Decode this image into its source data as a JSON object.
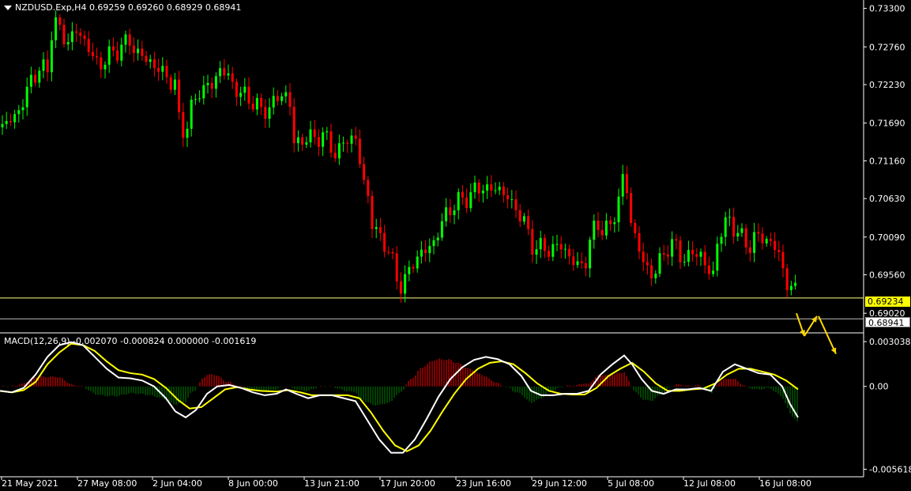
{
  "header": {
    "symbol_line": "NZDUSD.Exp,H4  0.69259 0.69260 0.68929 0.68941"
  },
  "macd_header": {
    "label": "MACD(12,26,9) -0.002070 -0.000824 0.000000 -0.001619"
  },
  "price_tags": {
    "horizontal_line": "0.69234",
    "current": "0.68941"
  },
  "colors": {
    "background": "#000000",
    "bull": "#00ff00",
    "bear": "#ff0000",
    "grid_line": "#ffffff",
    "level_line": "#ffff80",
    "signal": "#ffff00",
    "macd_main": "#ffffff",
    "hist_pos": "#ff0000",
    "hist_neg": "#008000",
    "arrow": "#ffd700"
  },
  "chart_data": [
    {
      "type": "candlestick",
      "title": "NZDUSD.Exp,H4",
      "y_ticks": [
        "0.73300",
        "0.72760",
        "0.72230",
        "0.71690",
        "0.71160",
        "0.70630",
        "0.70090",
        "0.69560",
        "0.69020"
      ],
      "ylim": [
        0.688,
        0.7334
      ],
      "x_ticks": [
        "21 May 2021",
        "27 May 08:00",
        "2 Jun 04:00",
        "8 Jun 00:00",
        "13 Jun 21:00",
        "17 Jun 20:00",
        "23 Jun 16:00",
        "29 Jun 12:00",
        "5 Jul 08:00",
        "12 Jul 08:00",
        "16 Jul 08:00"
      ],
      "horizontal_level": 0.69234,
      "last_price": 0.68941,
      "close_path": [
        [
          0,
          0.7163
        ],
        [
          10,
          0.717
        ],
        [
          20,
          0.718
        ],
        [
          30,
          0.72
        ],
        [
          40,
          0.7232
        ],
        [
          50,
          0.7245
        ],
        [
          60,
          0.7242
        ],
        [
          67,
          0.7315
        ],
        [
          73,
          0.7305
        ],
        [
          80,
          0.729
        ],
        [
          88,
          0.7283
        ],
        [
          95,
          0.73
        ],
        [
          102,
          0.7292
        ],
        [
          110,
          0.728
        ],
        [
          118,
          0.726
        ],
        [
          125,
          0.7248
        ],
        [
          135,
          0.7262
        ],
        [
          145,
          0.7268
        ],
        [
          155,
          0.7278
        ],
        [
          165,
          0.7285
        ],
        [
          172,
          0.7268
        ],
        [
          180,
          0.7262
        ],
        [
          190,
          0.7256
        ],
        [
          198,
          0.7245
        ],
        [
          208,
          0.724
        ],
        [
          215,
          0.7228
        ],
        [
          222,
          0.7222
        ],
        [
          228,
          0.716
        ],
        [
          236,
          0.7162
        ],
        [
          244,
          0.7195
        ],
        [
          252,
          0.7215
        ],
        [
          260,
          0.7218
        ],
        [
          268,
          0.7222
        ],
        [
          278,
          0.7245
        ],
        [
          288,
          0.7236
        ],
        [
          296,
          0.722
        ],
        [
          305,
          0.721
        ],
        [
          313,
          0.7205
        ],
        [
          322,
          0.7198
        ],
        [
          330,
          0.7185
        ],
        [
          340,
          0.719
        ],
        [
          350,
          0.7202
        ],
        [
          358,
          0.7212
        ],
        [
          366,
          0.7205
        ],
        [
          372,
          0.714
        ],
        [
          380,
          0.7145
        ],
        [
          390,
          0.7147
        ],
        [
          400,
          0.715
        ],
        [
          410,
          0.715
        ],
        [
          418,
          0.714
        ],
        [
          426,
          0.7122
        ],
        [
          434,
          0.714
        ],
        [
          442,
          0.715
        ],
        [
          452,
          0.7145
        ],
        [
          458,
          0.709
        ],
        [
          465,
          0.7075
        ],
        [
          472,
          0.702
        ],
        [
          480,
          0.701
        ],
        [
          488,
          0.7
        ],
        [
          495,
          0.698
        ],
        [
          500,
          0.6958
        ],
        [
          506,
          0.694
        ],
        [
          514,
          0.695
        ],
        [
          522,
          0.6972
        ],
        [
          530,
          0.6985
        ],
        [
          540,
          0.699
        ],
        [
          548,
          0.7
        ],
        [
          556,
          0.702
        ],
        [
          564,
          0.704
        ],
        [
          572,
          0.7052
        ],
        [
          582,
          0.706
        ],
        [
          592,
          0.7065
        ],
        [
          602,
          0.7075
        ],
        [
          612,
          0.708
        ],
        [
          620,
          0.7074
        ],
        [
          630,
          0.7078
        ],
        [
          640,
          0.707
        ],
        [
          648,
          0.7052
        ],
        [
          656,
          0.7048
        ],
        [
          664,
          0.7028
        ],
        [
          672,
          0.6998
        ],
        [
          682,
          0.6995
        ],
        [
          692,
          0.699
        ],
        [
          702,
          0.6995
        ],
        [
          712,
          0.6996
        ],
        [
          722,
          0.698
        ],
        [
          730,
          0.6968
        ],
        [
          740,
          0.697
        ],
        [
          748,
          0.701
        ],
        [
          756,
          0.7028
        ],
        [
          764,
          0.702
        ],
        [
          772,
          0.702
        ],
        [
          780,
          0.705
        ],
        [
          788,
          0.709
        ],
        [
          795,
          0.707
        ],
        [
          800,
          0.7015
        ],
        [
          806,
          0.701
        ],
        [
          812,
          0.6975
        ],
        [
          820,
          0.6962
        ],
        [
          828,
          0.6958
        ],
        [
          836,
          0.6975
        ],
        [
          844,
          0.6995
        ],
        [
          852,
          0.7
        ],
        [
          860,
          0.6985
        ],
        [
          868,
          0.6978
        ],
        [
          876,
          0.6985
        ],
        [
          886,
          0.6988
        ],
        [
          894,
          0.6965
        ],
        [
          902,
          0.695
        ],
        [
          908,
          0.7005
        ],
        [
          916,
          0.7025
        ],
        [
          924,
          0.7032
        ],
        [
          932,
          0.7018
        ],
        [
          940,
          0.7005
        ],
        [
          948,
          0.6995
        ],
        [
          956,
          0.701
        ],
        [
          964,
          0.7008
        ],
        [
          972,
          0.7005
        ],
        [
          980,
          0.6995
        ],
        [
          988,
          0.698
        ],
        [
          994,
          0.6948
        ],
        [
          1000,
          0.6935
        ],
        [
          1006,
          0.694
        ],
        [
          1011,
          0.6894
        ]
      ],
      "forecast_arrows": [
        [
          [
            1008,
            0.6902
          ],
          [
            1018,
            0.687
          ]
        ],
        [
          [
            1018,
            0.687
          ],
          [
            1034,
            0.6898
          ]
        ],
        [
          [
            1036,
            0.6898
          ],
          [
            1058,
            0.6845
          ]
        ]
      ]
    },
    {
      "type": "macd",
      "title": "MACD(12,26,9)",
      "y_ticks": [
        "0.003038",
        "0.00",
        "-0.005618"
      ],
      "ylim": [
        -0.0057,
        0.00315
      ],
      "macd_path": [
        [
          0,
          -0.0003
        ],
        [
          15,
          -0.0004
        ],
        [
          30,
          -0.0001
        ],
        [
          45,
          0.0008
        ],
        [
          60,
          0.002
        ],
        [
          75,
          0.0028
        ],
        [
          90,
          0.003
        ],
        [
          105,
          0.0028
        ],
        [
          120,
          0.002
        ],
        [
          135,
          0.0012
        ],
        [
          150,
          0.0006
        ],
        [
          165,
          0.00055
        ],
        [
          180,
          0.0004
        ],
        [
          195,
          0.0
        ],
        [
          210,
          -0.0008
        ],
        [
          222,
          -0.0017
        ],
        [
          235,
          -0.0021
        ],
        [
          248,
          -0.0016
        ],
        [
          262,
          -0.0005
        ],
        [
          275,
          0.0
        ],
        [
          290,
          0.0001
        ],
        [
          305,
          -0.0001
        ],
        [
          320,
          -0.0004
        ],
        [
          335,
          -0.0006
        ],
        [
          350,
          -0.0005
        ],
        [
          362,
          -0.0002
        ],
        [
          375,
          -0.0005
        ],
        [
          390,
          -0.0008
        ],
        [
          405,
          -0.0006
        ],
        [
          420,
          -0.0006
        ],
        [
          435,
          -0.0008
        ],
        [
          450,
          -0.001
        ],
        [
          465,
          -0.0023
        ],
        [
          480,
          -0.0036
        ],
        [
          495,
          -0.0045
        ],
        [
          510,
          -0.0045
        ],
        [
          525,
          -0.0036
        ],
        [
          540,
          -0.0022
        ],
        [
          555,
          -0.0007
        ],
        [
          570,
          0.0005
        ],
        [
          585,
          0.0013
        ],
        [
          600,
          0.0018
        ],
        [
          615,
          0.002
        ],
        [
          630,
          0.00185
        ],
        [
          645,
          0.0015
        ],
        [
          660,
          0.0007
        ],
        [
          672,
          -0.0003
        ],
        [
          685,
          -0.0006
        ],
        [
          700,
          -0.0006
        ],
        [
          715,
          -0.0005
        ],
        [
          730,
          -0.0005
        ],
        [
          745,
          -0.0003
        ],
        [
          760,
          0.0008
        ],
        [
          775,
          0.0015
        ],
        [
          790,
          0.0021
        ],
        [
          800,
          0.0015
        ],
        [
          812,
          0.0005
        ],
        [
          825,
          -0.0003
        ],
        [
          840,
          -0.0005
        ],
        [
          855,
          -0.0002
        ],
        [
          870,
          -0.0002
        ],
        [
          885,
          -0.0001
        ],
        [
          900,
          -0.0003
        ],
        [
          915,
          0.001
        ],
        [
          930,
          0.0015
        ],
        [
          945,
          0.0012
        ],
        [
          960,
          0.0009
        ],
        [
          975,
          0.0008
        ],
        [
          990,
          0.0
        ],
        [
          1000,
          -0.0012
        ],
        [
          1010,
          -0.0021
        ]
      ],
      "signal_path": [
        [
          0,
          -0.0003
        ],
        [
          15,
          -0.0004
        ],
        [
          30,
          -0.00025
        ],
        [
          45,
          0.0003
        ],
        [
          60,
          0.0015
        ],
        [
          75,
          0.0023
        ],
        [
          90,
          0.0029
        ],
        [
          105,
          0.0028
        ],
        [
          120,
          0.0024
        ],
        [
          135,
          0.0017
        ],
        [
          150,
          0.0011
        ],
        [
          165,
          0.0009
        ],
        [
          180,
          0.0008
        ],
        [
          195,
          0.0005
        ],
        [
          210,
          -0.0001
        ],
        [
          225,
          -0.0009
        ],
        [
          240,
          -0.0015
        ],
        [
          255,
          -0.0014
        ],
        [
          270,
          -0.0008
        ],
        [
          285,
          -0.0002
        ],
        [
          300,
          -5e-05
        ],
        [
          315,
          -0.0002
        ],
        [
          330,
          -0.0003
        ],
        [
          350,
          -0.00035
        ],
        [
          365,
          -0.00025
        ],
        [
          380,
          -0.0004
        ],
        [
          395,
          -0.0006
        ],
        [
          410,
          -0.0006
        ],
        [
          425,
          -0.0006
        ],
        [
          440,
          -0.0006
        ],
        [
          455,
          -0.0008
        ],
        [
          470,
          -0.0018
        ],
        [
          485,
          -0.003
        ],
        [
          500,
          -0.004
        ],
        [
          515,
          -0.0044
        ],
        [
          530,
          -0.004
        ],
        [
          545,
          -0.003
        ],
        [
          560,
          -0.0017
        ],
        [
          575,
          -0.0005
        ],
        [
          590,
          0.0005
        ],
        [
          605,
          0.0012
        ],
        [
          620,
          0.0016
        ],
        [
          635,
          0.0017
        ],
        [
          650,
          0.0015
        ],
        [
          665,
          0.0009
        ],
        [
          680,
          0.0002
        ],
        [
          695,
          -0.0003
        ],
        [
          710,
          -0.0005
        ],
        [
          725,
          -0.00055
        ],
        [
          740,
          -0.00055
        ],
        [
          755,
          -0.0001
        ],
        [
          770,
          0.0007
        ],
        [
          785,
          0.0012
        ],
        [
          800,
          0.0016
        ],
        [
          815,
          0.001
        ],
        [
          830,
          0.0002
        ],
        [
          845,
          -0.0003
        ],
        [
          860,
          -0.0003
        ],
        [
          875,
          -0.0002
        ],
        [
          890,
          -0.00015
        ],
        [
          905,
          0.0002
        ],
        [
          920,
          0.0008
        ],
        [
          935,
          0.0012
        ],
        [
          950,
          0.0012
        ],
        [
          965,
          0.001
        ],
        [
          980,
          0.0008
        ],
        [
          995,
          0.0004
        ],
        [
          1010,
          -0.0002
        ]
      ]
    }
  ]
}
